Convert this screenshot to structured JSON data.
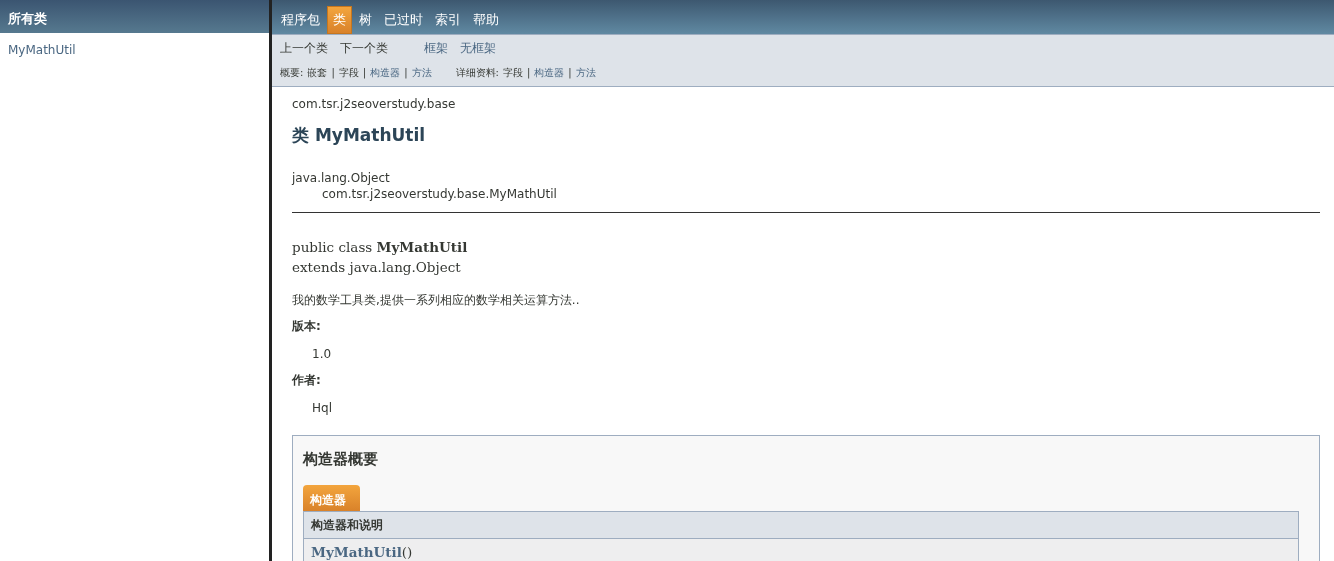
{
  "left_frame": {
    "title": "所有类",
    "classes": [
      {
        "label": "MyMathUtil"
      }
    ]
  },
  "top_nav": {
    "items": [
      {
        "label": "程序包",
        "selected": false
      },
      {
        "label": "类",
        "selected": true
      },
      {
        "label": "树",
        "selected": false
      },
      {
        "label": "已过时",
        "selected": false
      },
      {
        "label": "索引",
        "selected": false
      },
      {
        "label": "帮助",
        "selected": false
      }
    ]
  },
  "sub_nav": {
    "links": [
      {
        "label": "上一个类",
        "link": false
      },
      {
        "label": "下一个类",
        "link": false
      },
      {
        "label": "框架",
        "link": true
      },
      {
        "label": "无框架",
        "link": true
      }
    ],
    "summary": {
      "label": "概要:",
      "separator": "|",
      "items": [
        {
          "label": "嵌套",
          "link": false
        },
        {
          "label": "字段",
          "link": false
        },
        {
          "label": "构造器",
          "link": true
        },
        {
          "label": "方法",
          "link": true
        }
      ]
    },
    "detail": {
      "label": "详细资料:",
      "separator": "|",
      "items": [
        {
          "label": "字段",
          "link": false
        },
        {
          "label": "构造器",
          "link": true
        },
        {
          "label": "方法",
          "link": true
        }
      ]
    }
  },
  "header": {
    "package": "com.tsr.j2seoverstudy.base",
    "title": "类 MyMathUtil"
  },
  "inheritance": [
    "java.lang.Object",
    "com.tsr.j2seoverstudy.base.MyMathUtil"
  ],
  "signature": [
    "public class **MyMathUtil**",
    "extends java.lang.Object"
  ],
  "description": "我的数学工具类,提供一系列相应的数学相关运算方法..",
  "tags": [
    {
      "label": "版本:",
      "value": "1.0"
    },
    {
      "label": "作者:",
      "value": "Hql"
    }
  ],
  "constructor_summary": {
    "title": "构造器概要",
    "tab": "构造器",
    "column": "构造器和说明",
    "rows": [
      {
        "name": "MyMathUtil",
        "params": "()"
      }
    ]
  }
}
